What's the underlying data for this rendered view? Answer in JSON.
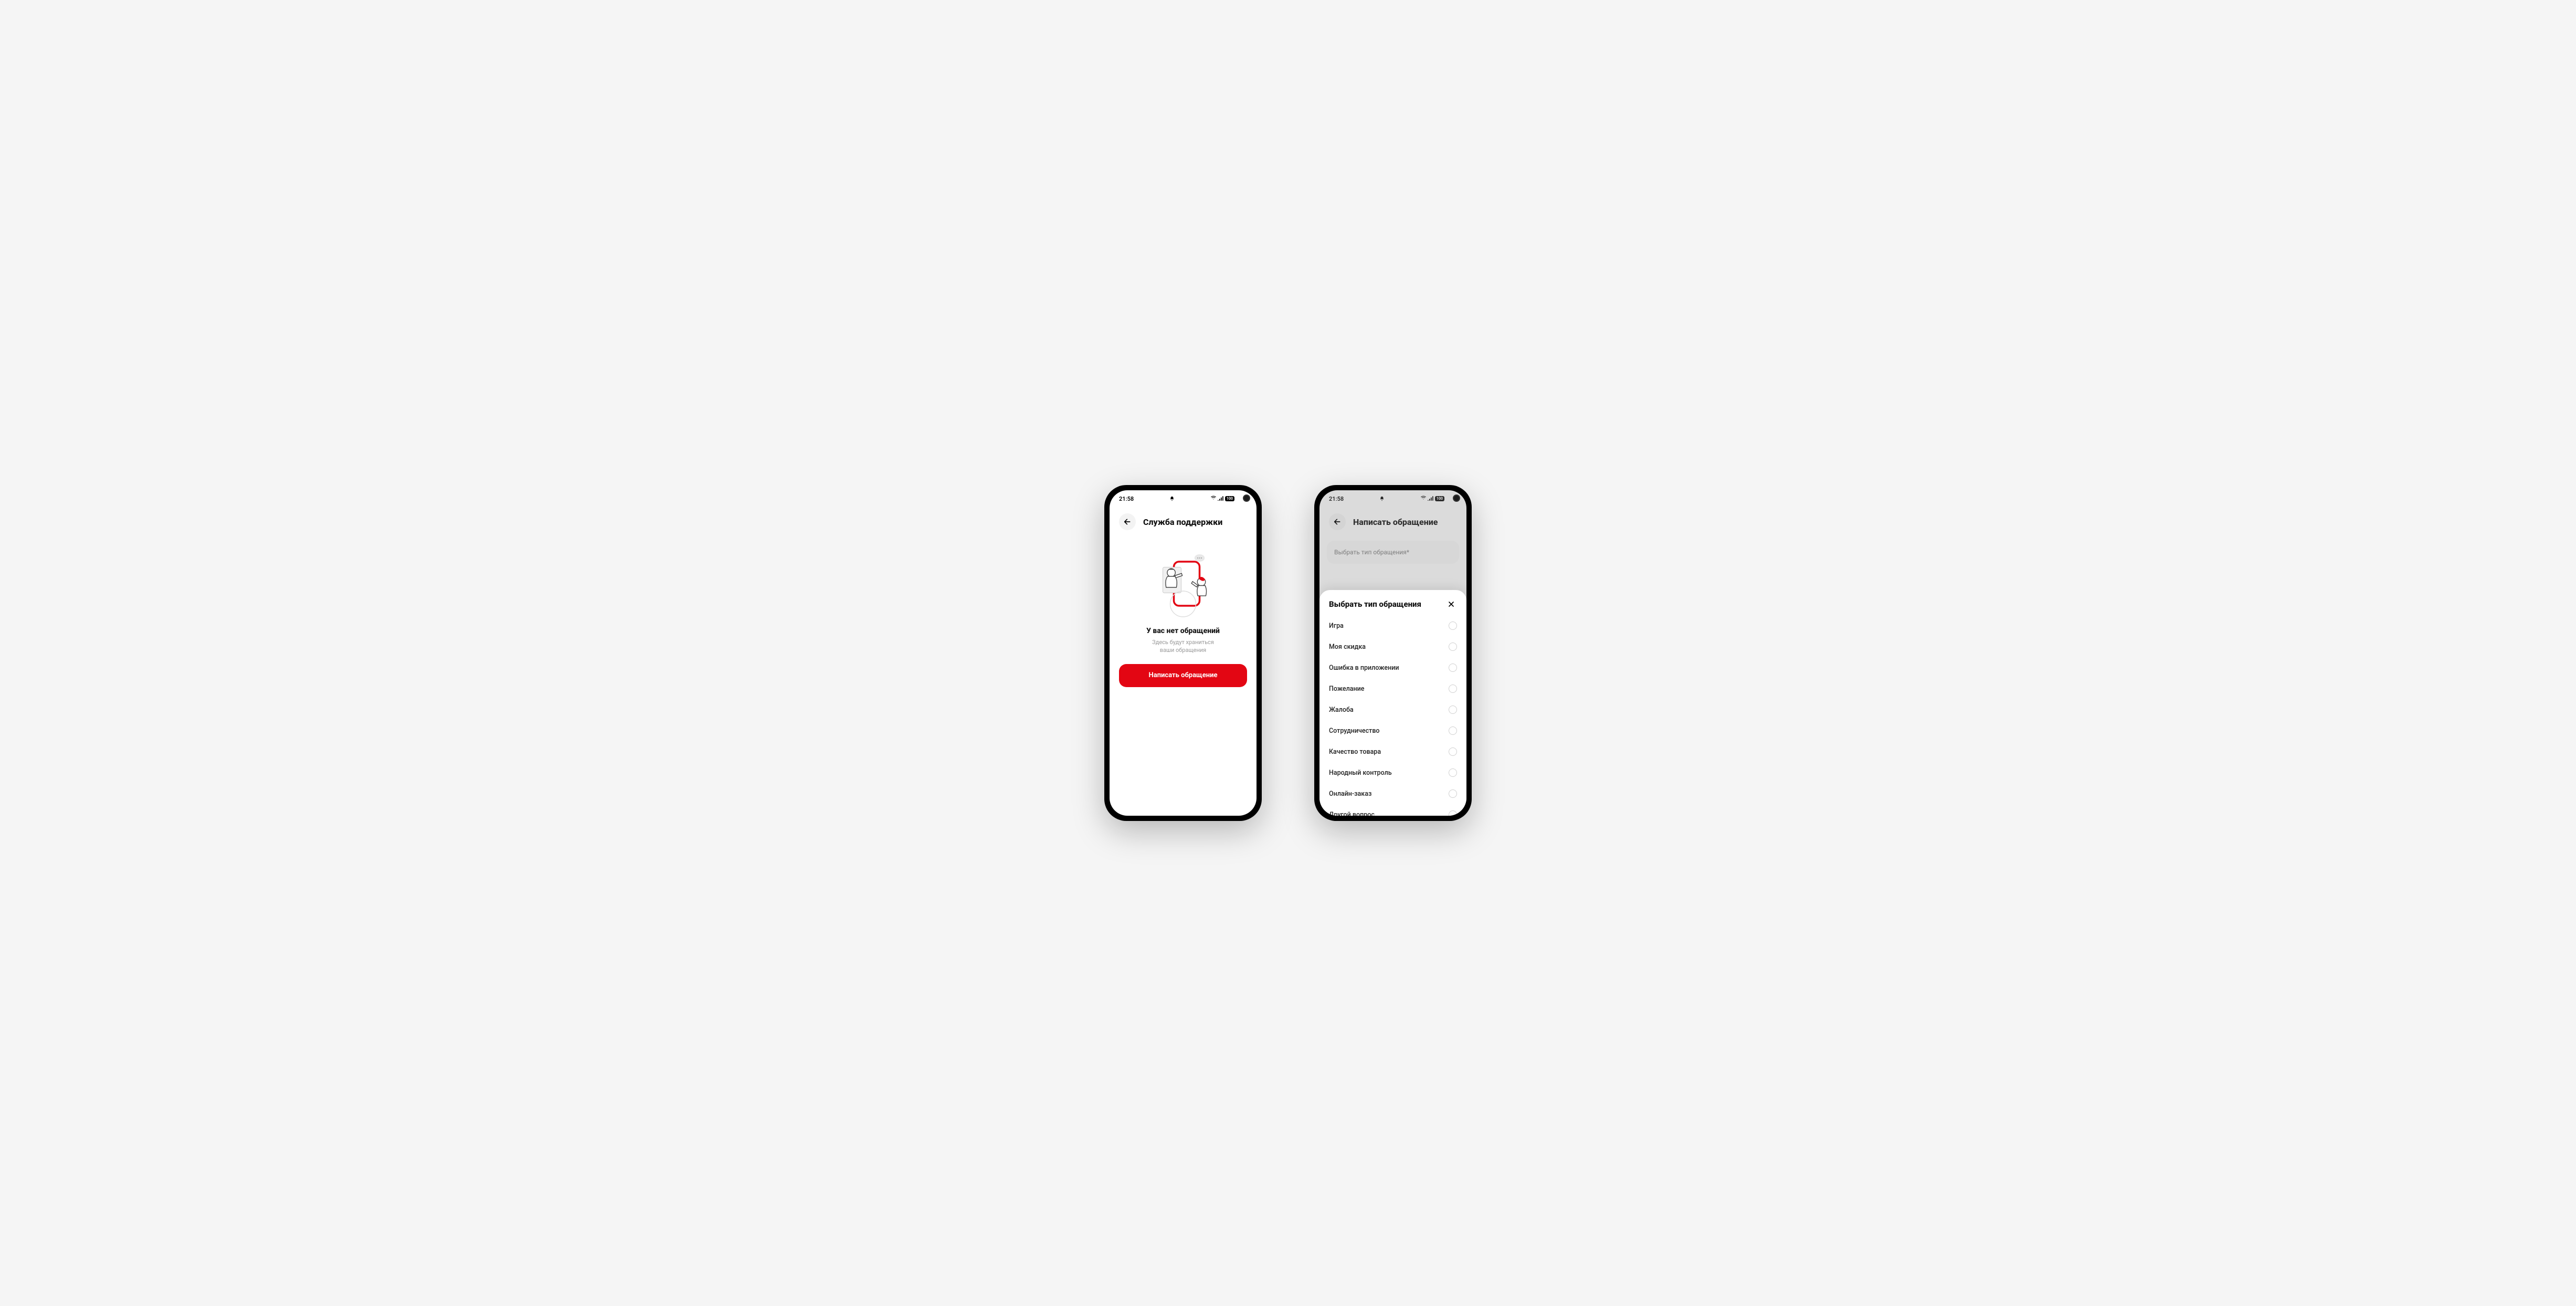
{
  "status": {
    "time": "21:58",
    "battery": "100"
  },
  "phone1": {
    "title": "Служба поддержки",
    "empty_title": "У вас нет обращений",
    "empty_sub_line1": "Здесь будут храниться",
    "empty_sub_line2": "ваши обращения",
    "cta": "Написать обращение"
  },
  "phone2": {
    "title": "Написать обращение",
    "field_placeholder": "Выбрать тип обращения*",
    "sheet_title": "Выбрать тип обращения",
    "options": [
      "Игра",
      "Моя скидка",
      "Ошибка в приложении",
      "Пожелание",
      "Жалоба",
      "Сотрудничество",
      "Качество товара",
      "Народный контроль",
      "Онлайн-заказ",
      "Другой вопрос"
    ]
  }
}
